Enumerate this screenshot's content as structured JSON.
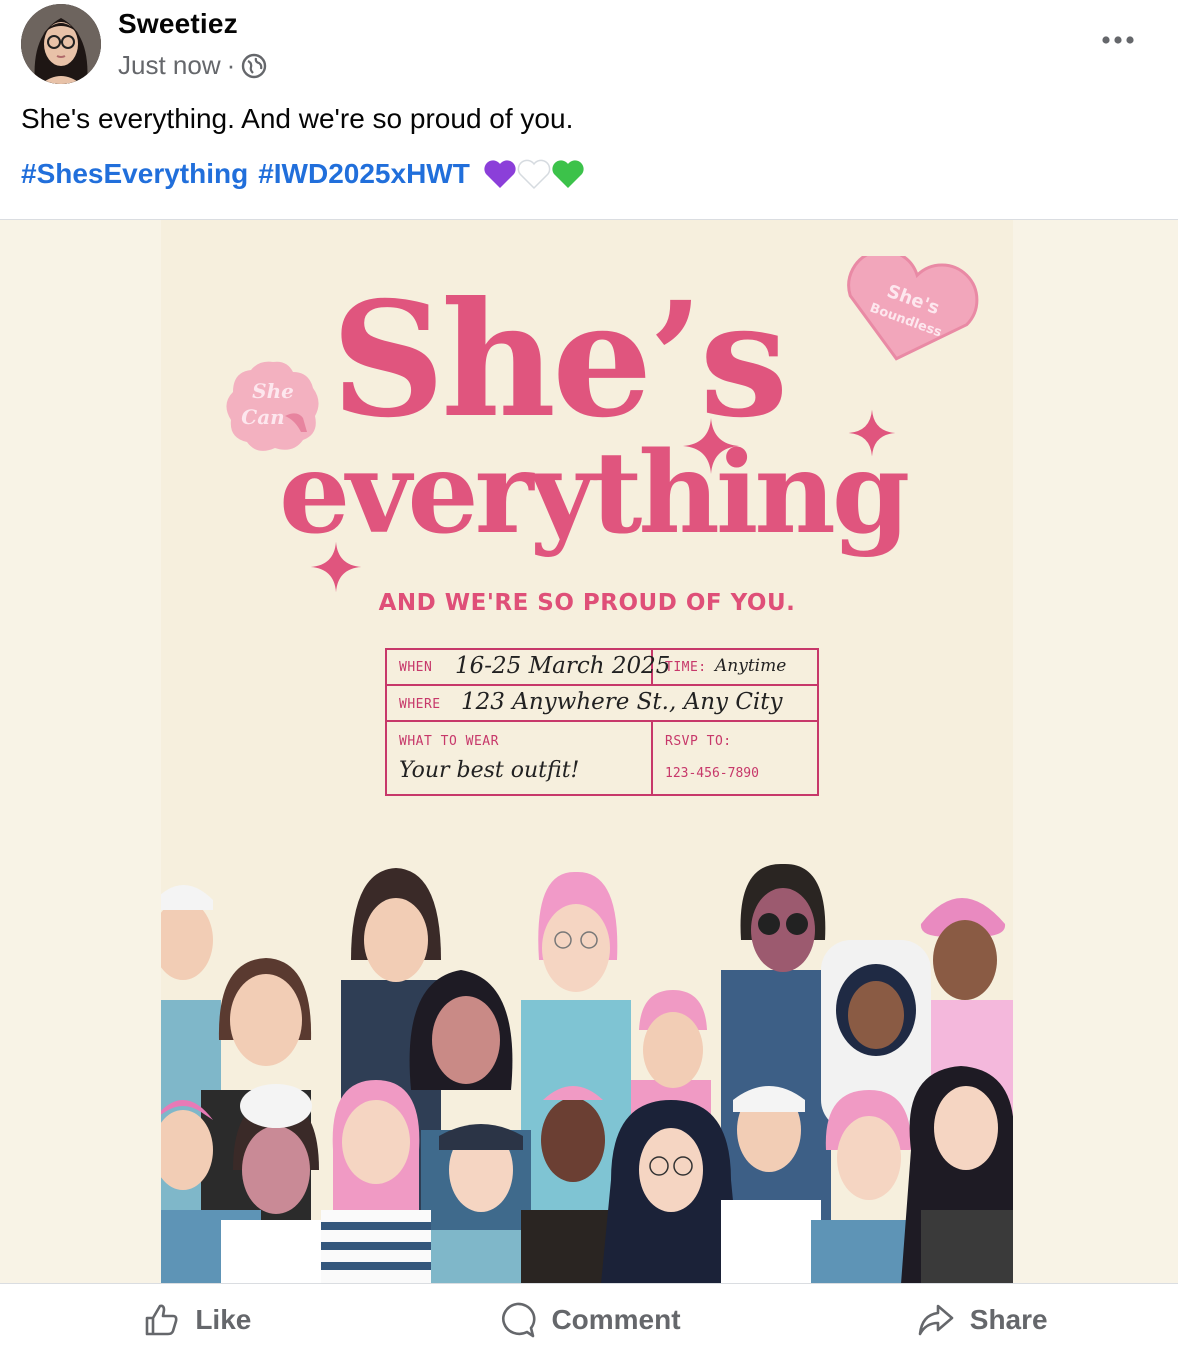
{
  "post": {
    "author": "Sweetiez",
    "timestamp": "Just now",
    "separator": "·",
    "caption": "She's everything. And we're so proud of you.",
    "hashtags": [
      "#ShesEverything",
      "#IWD2025xHWT"
    ],
    "heart_colors": [
      "#8b3fd9",
      "#ffffff",
      "#3cc24a"
    ]
  },
  "poster": {
    "title_line1": "She’s",
    "title_line2": "everything",
    "subtitle": "AND WE'RE SO PROUD OF YOU.",
    "badge_left": [
      "She",
      "Can"
    ],
    "badge_right": [
      "She's",
      "Boundless"
    ],
    "when_label": "WHEN",
    "when_value": "16-25 March 2025",
    "time_label": "TIME:",
    "time_value": "Anytime",
    "where_label": "WHERE",
    "where_value": "123 Anywhere St., Any City",
    "wear_label": "WHAT TO WEAR",
    "wear_value": "Your best outfit!",
    "rsvp_label": "RSVP TO:",
    "rsvp_value": "123-456-7890",
    "accent_color": "#e0557e"
  },
  "actions": {
    "like": "Like",
    "comment": "Comment",
    "share": "Share"
  }
}
